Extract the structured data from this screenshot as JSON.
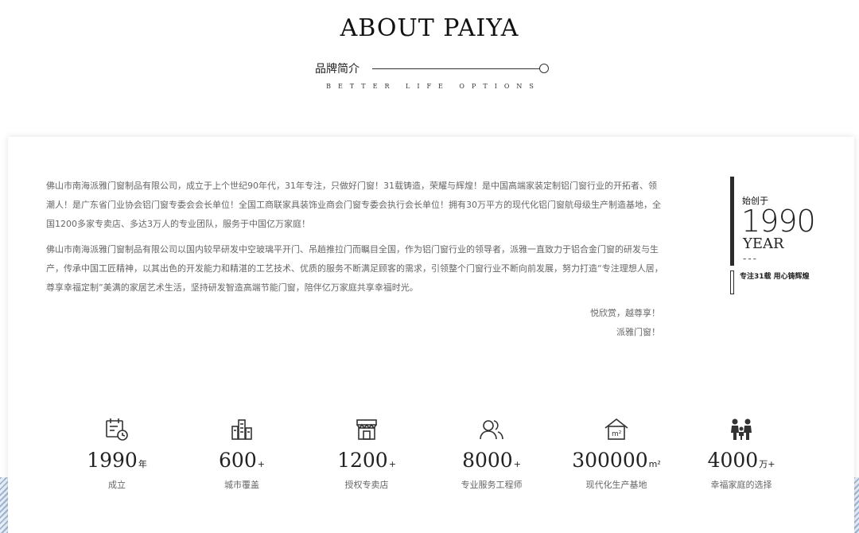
{
  "header": {
    "title": "ABOUT PAIYA",
    "subtitle": "品牌简介",
    "tagline": "BETTER LIFE OPTIONS"
  },
  "intro": {
    "paragraph1": "佛山市南海派雅门窗制品有限公司，成立于上个世纪90年代，31年专注，只做好门窗！31载铸造，荣耀与辉煌！是中国高端家装定制铝门窗行业的开拓者、领潮人！是广东省门业协会铝门窗专委会会长单位！全国工商联家具装饰业商会门窗专委会执行会长单位！拥有30万平方的现代化铝门窗航母级生产制造基地，全国1200多家专卖店、多达3万人的专业团队，服务于中国亿万家庭！",
    "paragraph2": "佛山市南海派雅门窗制品有限公司以国内较早研发中空玻璃平开门、吊趟推拉门而瞩目全国，作为铝门窗行业的领导者，派雅一直致力于铝合金门窗的研发与生产，传承中国工匠精神，以其出色的开发能力和精湛的工艺技术、优质的服务不断满足顾客的需求，引领整个门窗行业不断向前发展，努力打造“专注理想人居，尊享幸福定制”美满的家居艺术生活，坚持研发智造高端节能门窗，陪伴亿万家庭共享幸福时光。",
    "sign_line1": "悦欣赏，越尊享！",
    "sign_line2": "派雅门窗！"
  },
  "since": {
    "label": "始创于",
    "year": "1990",
    "unit": "YEAR",
    "dash": "---",
    "slogan": "专注31载 用心铸辉煌"
  },
  "stats": [
    {
      "icon": "calendar-clock-icon",
      "value": "1990",
      "unit": "年",
      "label": "成立"
    },
    {
      "icon": "city-buildings-icon",
      "value": "600",
      "unit": "+",
      "label": "城市覆盖"
    },
    {
      "icon": "store-icon",
      "value": "1200",
      "unit": "+",
      "label": "授权专卖店"
    },
    {
      "icon": "people-icon",
      "value": "8000",
      "unit": "+",
      "label": "专业服务工程师"
    },
    {
      "icon": "house-area-icon",
      "value": "300000",
      "unit": "m²",
      "label": "现代化生产基地"
    },
    {
      "icon": "family-icon",
      "value": "4000",
      "unit": "万+",
      "label": "幸福家庭的选择"
    }
  ],
  "colors": {
    "text_dark": "#222222",
    "text_body": "#666666",
    "accent_bar": "#2b2b2b",
    "background": "#ffffff"
  }
}
